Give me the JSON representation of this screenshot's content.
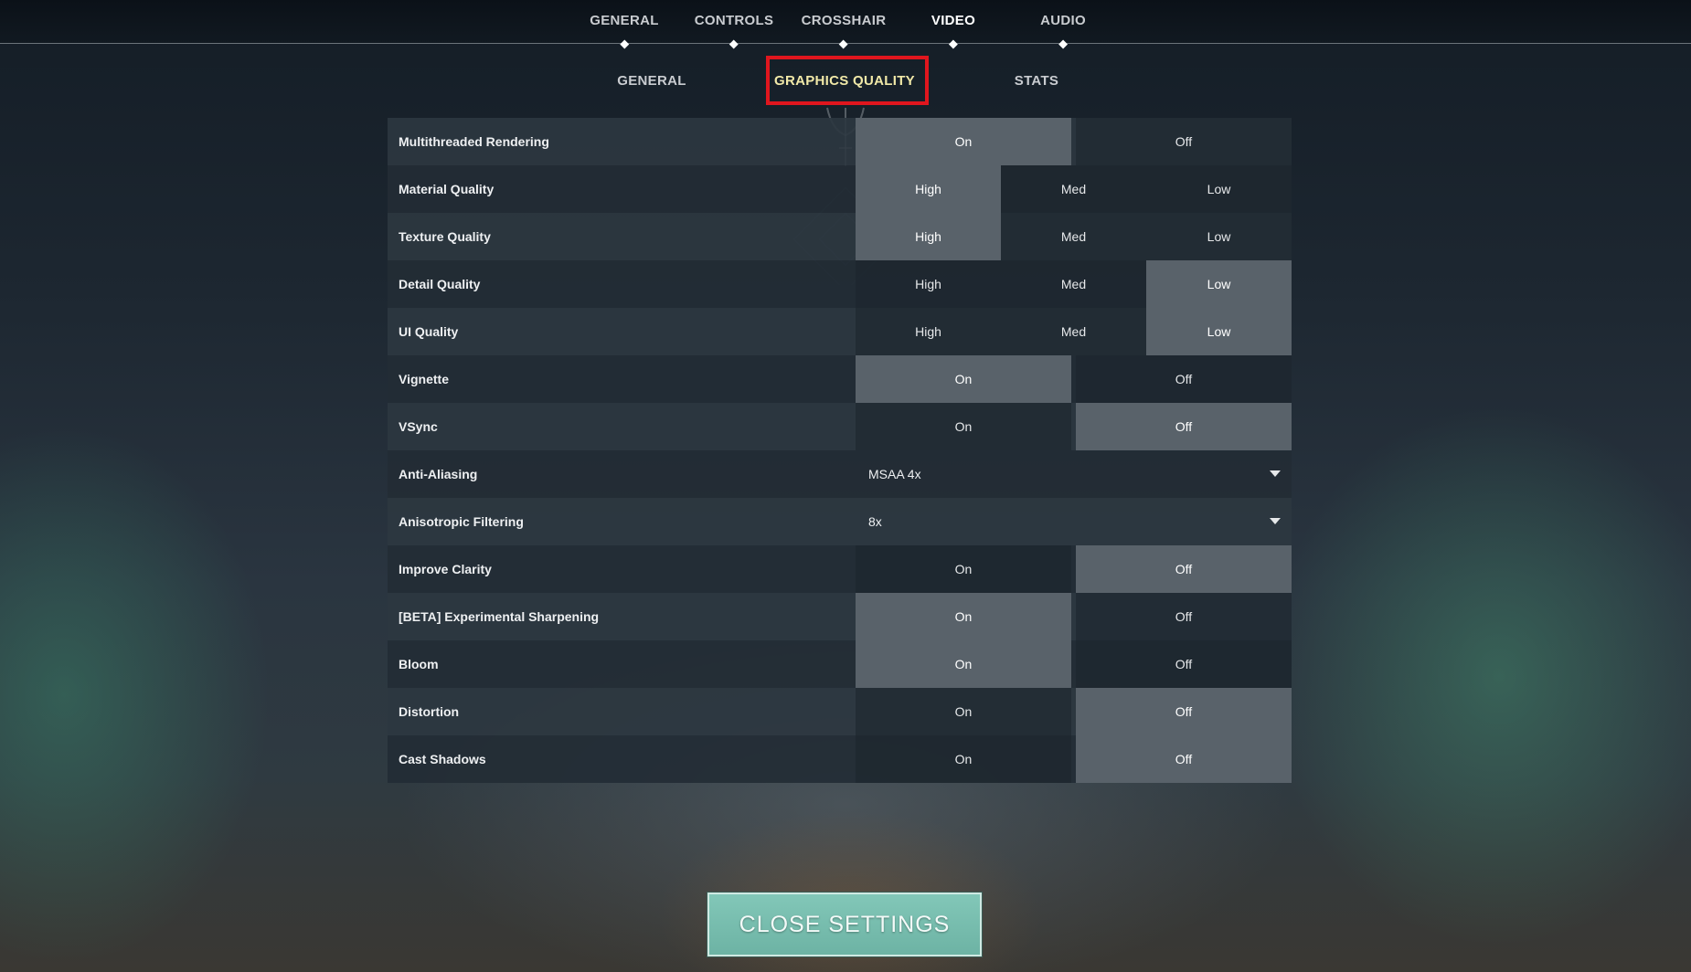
{
  "top_tabs": [
    {
      "label": "GENERAL"
    },
    {
      "label": "CONTROLS"
    },
    {
      "label": "CROSSHAIR"
    },
    {
      "label": "VIDEO",
      "active": true
    },
    {
      "label": "AUDIO"
    }
  ],
  "sub_tabs": [
    {
      "label": "GENERAL"
    },
    {
      "label": "GRAPHICS QUALITY",
      "active": true
    },
    {
      "label": "STATS"
    }
  ],
  "settings": [
    {
      "label": "Multithreaded Rendering",
      "options": [
        "On",
        "Off"
      ],
      "selected": "On"
    },
    {
      "label": "Material Quality",
      "options": [
        "High",
        "Med",
        "Low"
      ],
      "selected": "High"
    },
    {
      "label": "Texture Quality",
      "options": [
        "High",
        "Med",
        "Low"
      ],
      "selected": "High"
    },
    {
      "label": "Detail Quality",
      "options": [
        "High",
        "Med",
        "Low"
      ],
      "selected": "Low"
    },
    {
      "label": "UI Quality",
      "options": [
        "High",
        "Med",
        "Low"
      ],
      "selected": "Low"
    },
    {
      "label": "Vignette",
      "options": [
        "On",
        "Off"
      ],
      "selected": "On"
    },
    {
      "label": "VSync",
      "options": [
        "On",
        "Off"
      ],
      "selected": "Off"
    },
    {
      "label": "Anti-Aliasing",
      "dropdown": "MSAA 4x"
    },
    {
      "label": "Anisotropic Filtering",
      "dropdown": "8x"
    },
    {
      "label": "Improve Clarity",
      "options": [
        "On",
        "Off"
      ],
      "selected": "Off"
    },
    {
      "label": "[BETA] Experimental Sharpening",
      "options": [
        "On",
        "Off"
      ],
      "selected": "On"
    },
    {
      "label": "Bloom",
      "options": [
        "On",
        "Off"
      ],
      "selected": "On"
    },
    {
      "label": "Distortion",
      "options": [
        "On",
        "Off"
      ],
      "selected": "Off"
    },
    {
      "label": "Cast Shadows",
      "options": [
        "On",
        "Off"
      ],
      "selected": "Off"
    }
  ],
  "close_button": {
    "label": "CLOSE SETTINGS"
  },
  "colors": {
    "highlight_box": "#e0161e",
    "active_subtab": "#f1e9a8",
    "selected_option": "#59626a",
    "close_button": "#76bcad"
  }
}
